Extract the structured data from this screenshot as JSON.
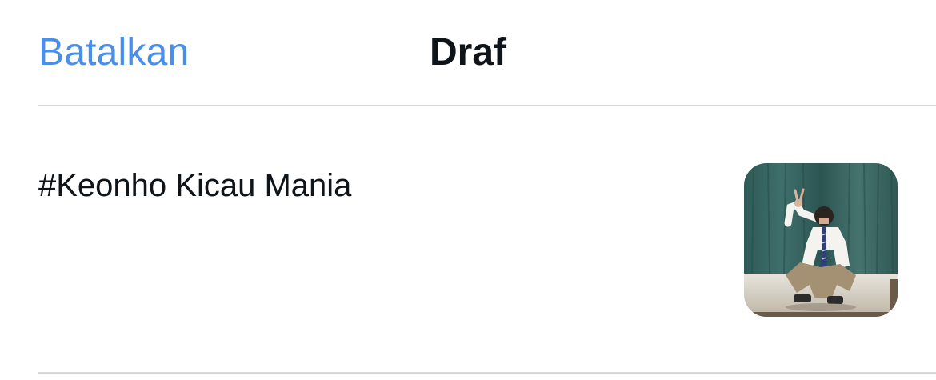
{
  "header": {
    "cancel_label": "Batalkan",
    "title": "Draf"
  },
  "drafts": [
    {
      "text": "#Keonho Kicau Mania",
      "thumbnail_icon": "photo-thumbnail"
    }
  ],
  "colors": {
    "accent": "#4a8fe7",
    "text": "#0f1419",
    "divider": "#d6d9db",
    "background": "#ffffff"
  }
}
